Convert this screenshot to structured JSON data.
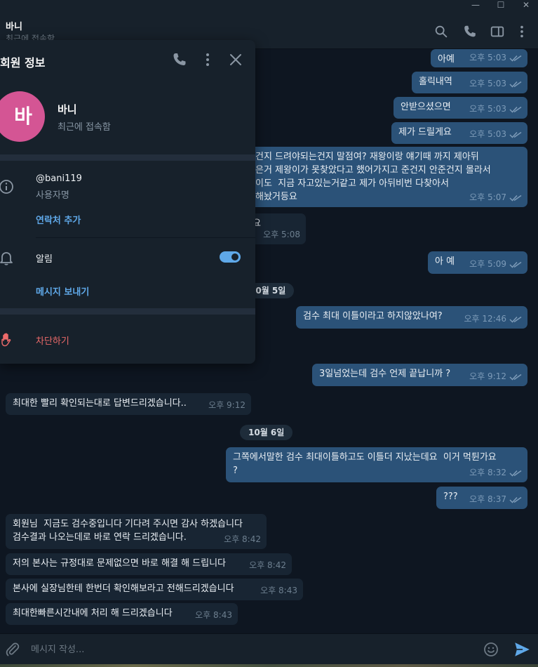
{
  "window": {
    "minimize_glyph": "—",
    "maximize_glyph": "☐",
    "close_glyph": "✕"
  },
  "chat": {
    "name": "바니",
    "status": "최근에 접속함"
  },
  "panel": {
    "title": "회원 정보",
    "avatar_letter": "바",
    "avatar_color": "#d45594",
    "name": "바니",
    "status": "최근에 접속함",
    "username": "@bani119",
    "username_label": "사용자명",
    "add_contact": "연락처 추가",
    "notifications_label": "알림",
    "notifications_on": true,
    "send_message": "메시지 보내기",
    "block": "차단하기"
  },
  "messages": [
    {
      "dir": "out",
      "text": "아예",
      "time": "오후 5:03"
    },
    {
      "dir": "out",
      "text": "홀릭내역",
      "time": "오후 5:03"
    },
    {
      "dir": "out",
      "text": "안받으셨으면",
      "time": "오후 5:03"
    },
    {
      "dir": "out",
      "text": "제가 드릴게요",
      "time": "오후 5:03"
    },
    {
      "dir": "out",
      "text": "건지 드려야되는건지 말점여? 재왕이랑 얘기때 까지 제아뒤\n은거 제왕이가 못찾았다고 했어가지고 준건지 안준건지 몰라서\n이도  지금 자고있는거같고 제가 아뒤비번 다찾아서\n해놨거등요",
      "time": "오후 5:07"
    },
    {
      "dir": "in",
      "text": "요",
      "time": "오후 5:08"
    },
    {
      "dir": "out",
      "text": "아 예",
      "time": "오후 5:09"
    },
    {
      "dir": "out",
      "text": "검수 최대 이틀이라고 하지않았나여?",
      "time": "오후 12:46"
    },
    {
      "dir": "out",
      "text": "3일넘었는데 검수 언제 끝납니까 ?",
      "time": "오후 9:12"
    },
    {
      "dir": "in",
      "text": "최대한 빨리 확인되는대로 답변드리겠습니다..",
      "time": "오후 9:12"
    },
    {
      "dir": "out",
      "text": "그쪽에서말한 검수 최대이틀하고도 이틀더 지났는데요  이거 먹튄가요\n?",
      "time": "오후 8:32"
    },
    {
      "dir": "out",
      "text": "???",
      "time": "오후 8:37"
    },
    {
      "dir": "in",
      "text": "회원님  지금도 검수중입니다 기다려 주시면 감사 하겠습니다\n검수결과 나오는데로 바로 연락 드리겠습니다.",
      "time": "오후 8:42"
    },
    {
      "dir": "in",
      "text": "저의 본사는 규정대로 문제없으면 바로 해결 해 드립니다",
      "time": "오후 8:42"
    },
    {
      "dir": "in",
      "text": "본사에 실장님한테 한번더 확인해보라고 전해드리겠습니다",
      "time": "오후 8:43"
    },
    {
      "dir": "in",
      "text": "최대한빠른시간내에 처리 해 드리겠습니다",
      "time": "오후 8:43"
    }
  ],
  "dates": [
    "10월 5일",
    "10월 6일"
  ],
  "composer": {
    "placeholder": "메시지 작성..."
  },
  "colors": {
    "bg": "#0e1621",
    "header": "#17212b",
    "out_bubble": "#2b5278",
    "in_bubble": "#182533",
    "accent": "#5fa8e8",
    "danger": "#ec6a6a"
  }
}
